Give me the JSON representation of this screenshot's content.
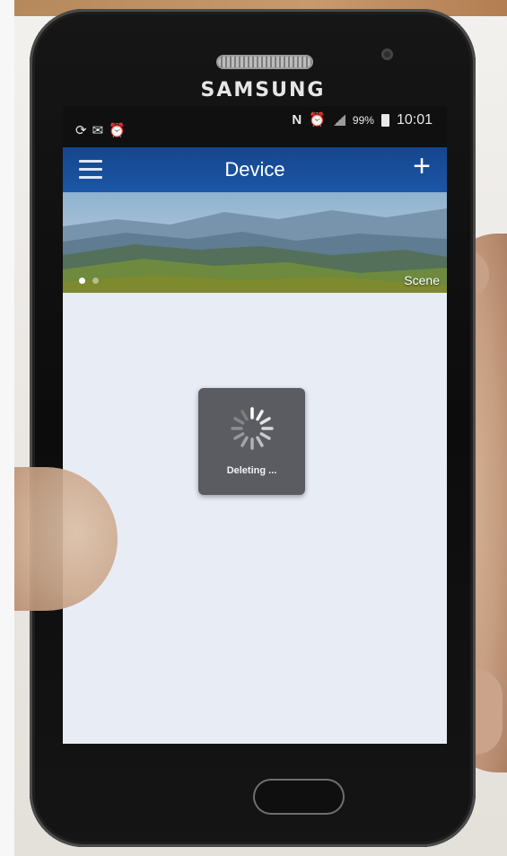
{
  "device": {
    "brand": "SAMSUNG"
  },
  "status_bar": {
    "left_icons": [
      "sync-icon",
      "mail-icon",
      "alarm-icon"
    ],
    "right_icons": [
      "nfc-icon",
      "alarm-icon",
      "signal-icon",
      "battery-icon"
    ],
    "battery_percent": "99%",
    "time": "10:01"
  },
  "app_bar": {
    "title": "Device",
    "menu_icon": "hamburger-icon",
    "add_icon": "plus-icon",
    "add_symbol": "+"
  },
  "banner": {
    "label": "Scene",
    "page_count": 2,
    "active_page": 1
  },
  "loading_dialog": {
    "message": "Deleting ...",
    "spinner_icon": "spinner-icon"
  },
  "colors": {
    "app_bar": "#1b56a6",
    "content_bg": "#e8ecf5",
    "dialog_bg": "#5a5c61"
  }
}
